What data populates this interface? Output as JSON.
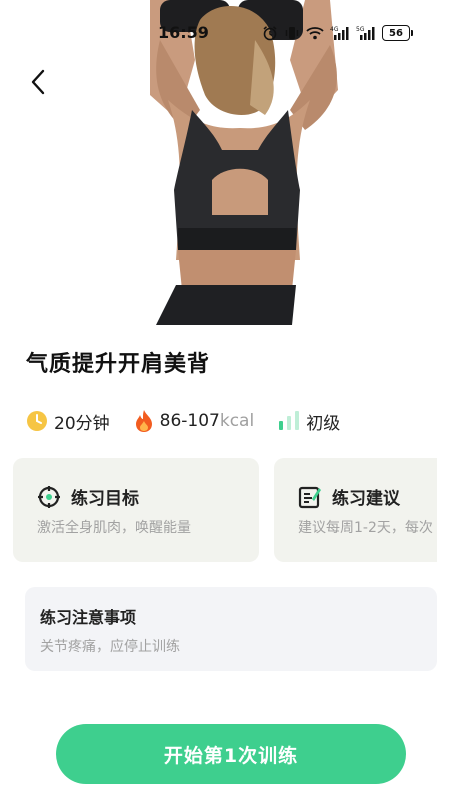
{
  "status_bar": {
    "time": "16:59",
    "battery": "56",
    "icons": [
      "alarm-icon",
      "vibrate-icon",
      "wifi-icon",
      "4g-signal-icon",
      "5g-signal-icon",
      "battery-icon"
    ]
  },
  "hero": {
    "image": "woman-back-workout-photo"
  },
  "workout": {
    "title": "气质提升开肩美背",
    "duration": "20分钟",
    "calories_value": "86-107",
    "calories_unit": "kcal",
    "level": "初级"
  },
  "cards": [
    {
      "title": "练习目标",
      "desc": "激活全身肌肉，唤醒能量",
      "icon": "target-icon"
    },
    {
      "title": "练习建议",
      "desc": "建议每周1-2天，每次",
      "icon": "edit-list-icon"
    }
  ],
  "notice": {
    "title": "练习注意事项",
    "desc": "关节疼痛，应停止训练"
  },
  "start_button": {
    "label": "开始第1次训练"
  },
  "colors": {
    "accent": "#3ecf8e",
    "clock": "#f6c544",
    "fire": "#f25c1f",
    "level_bars": "#3ecf8e",
    "card_bg": "#f2f3ee",
    "notice_bg": "#f3f4f7"
  }
}
